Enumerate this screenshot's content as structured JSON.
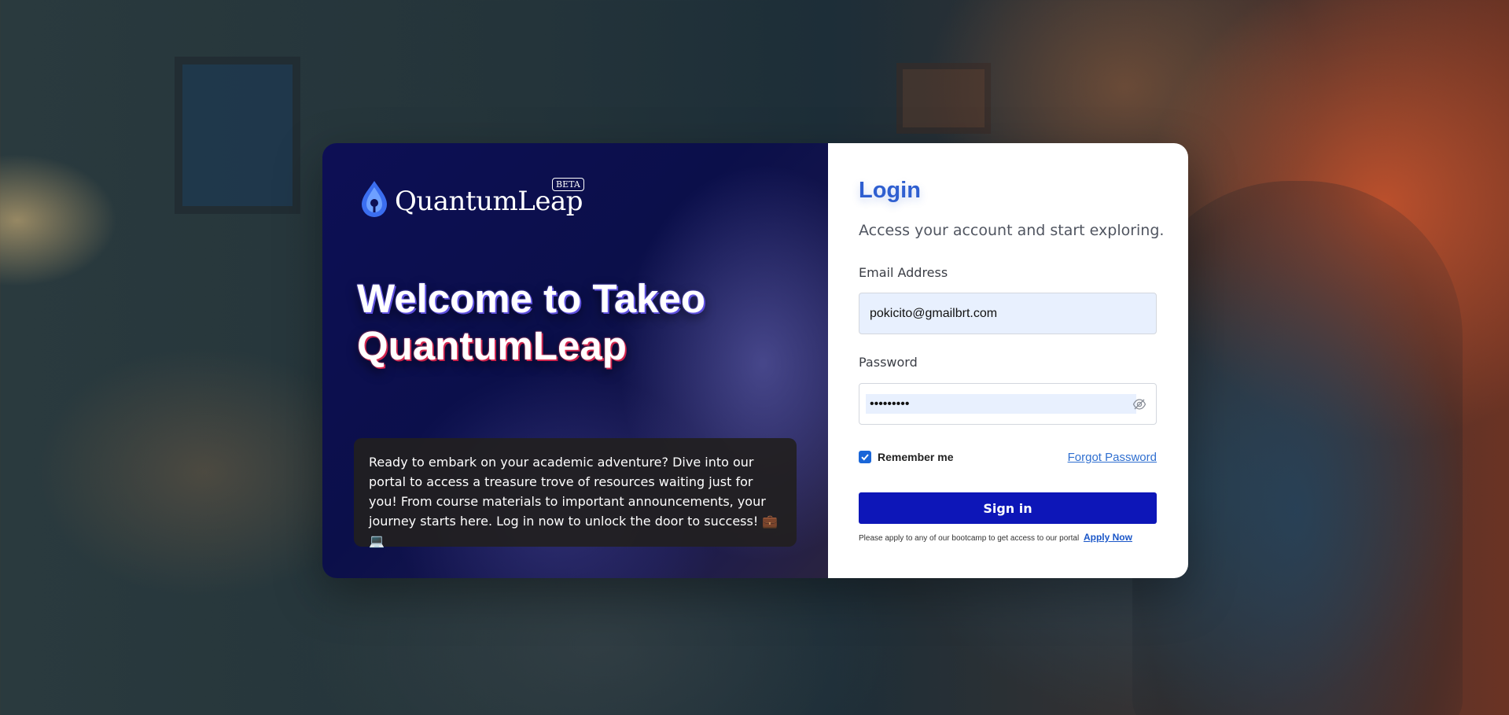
{
  "brand": {
    "name": "QuantumLeap",
    "badge": "BETA"
  },
  "hero": {
    "line1": "Welcome to Takeo",
    "line2": "QuantumLeap",
    "intro": "Ready to embark on your academic adventure? Dive into our portal to access a treasure trove of resources waiting just for you! From course materials to important announcements, your journey starts here. Log in now to unlock the door to success! 💼💻"
  },
  "login": {
    "title": "Login",
    "subtitle": "Access your account and start exploring.",
    "email_label": "Email Address",
    "email_value": "pokicito@gmailbrt.com",
    "password_label": "Password",
    "password_value": "•••••••••",
    "remember_label": "Remember me",
    "remember_checked": true,
    "forgot_label": "Forgot Password",
    "signin_label": "Sign in",
    "apply_text": "Please apply to any of our bootcamp to get access to our portal",
    "apply_link": "Apply Now"
  },
  "icons": {
    "logo": "droplet-logo-icon",
    "password_toggle": "eye-slash-icon",
    "checkbox": "check-icon"
  },
  "colors": {
    "accent": "#2f5fd0",
    "button": "#0d16b8",
    "panel_dark": "#0d0f55",
    "input_autofill": "#e8f0fe"
  }
}
